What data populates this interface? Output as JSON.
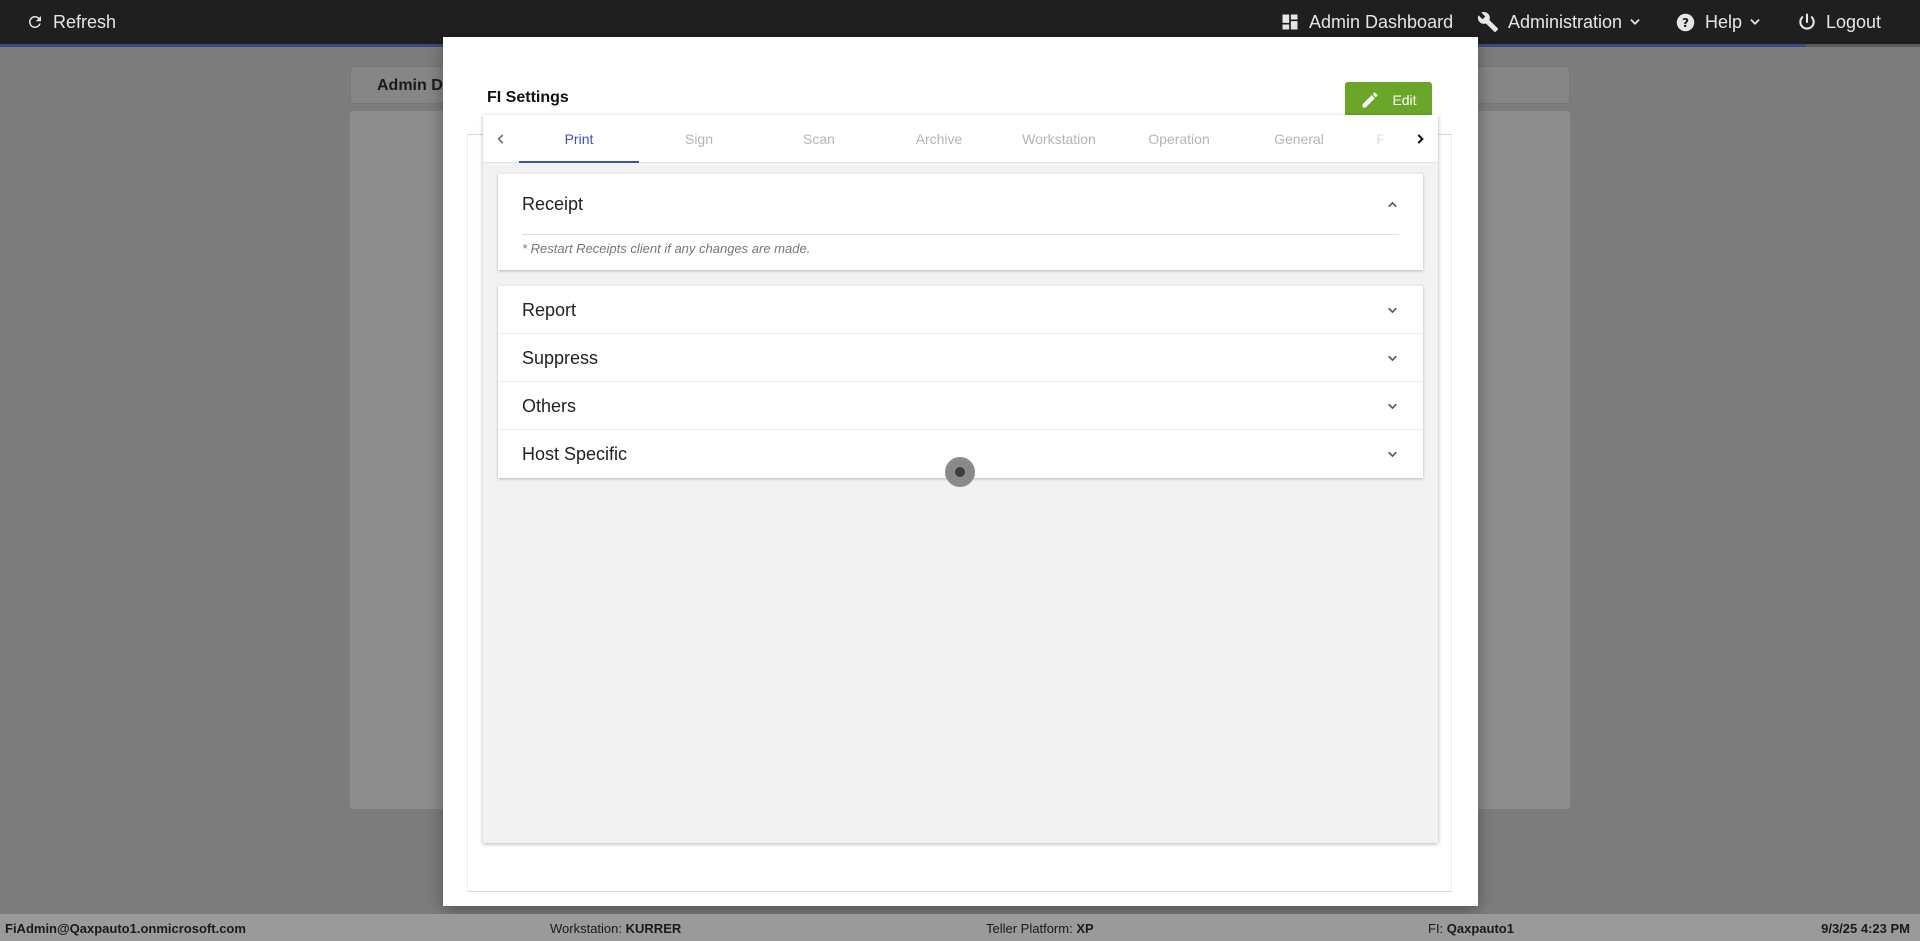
{
  "nav": {
    "refresh_label": "Refresh",
    "admin_dashboard_label": "Admin Dashboard",
    "administration_label": "Administration",
    "help_label": "Help",
    "logout_label": "Logout"
  },
  "background": {
    "tab_text": "Admin D"
  },
  "modal": {
    "title": "FI Settings",
    "edit_label": "Edit"
  },
  "tabs": [
    {
      "label": "Print",
      "active": true
    },
    {
      "label": "Sign",
      "active": false
    },
    {
      "label": "Scan",
      "active": false
    },
    {
      "label": "Archive",
      "active": false
    },
    {
      "label": "Workstation",
      "active": false
    },
    {
      "label": "Operation",
      "active": false
    },
    {
      "label": "General",
      "active": false
    },
    {
      "label": "F",
      "active": false
    }
  ],
  "receipt": {
    "title": "Receipt",
    "note": "* Restart Receipts client if any changes are made."
  },
  "panels": [
    {
      "title": "Report"
    },
    {
      "title": "Suppress"
    },
    {
      "title": "Others"
    },
    {
      "title": "Host Specific"
    }
  ],
  "status": {
    "user": "FiAdmin@Qaxpauto1.onmicrosoft.com",
    "workstation_label": "Workstation:",
    "workstation_value": "KURRER",
    "platform_label": "Teller Platform:",
    "platform_value": "XP",
    "fi_label": "FI:",
    "fi_value": "Qaxpauto1",
    "datetime": "9/3/25 4:23 PM"
  },
  "colors": {
    "accent": "#3f51b5",
    "edit_button": "#6aa627",
    "topbar": "#1f1f1f"
  },
  "icons": {
    "refresh": "refresh-icon",
    "dashboard": "dashboard-icon",
    "wrench": "wrench-icon",
    "help": "help-icon",
    "power": "power-icon",
    "pencil": "pencil-icon"
  }
}
